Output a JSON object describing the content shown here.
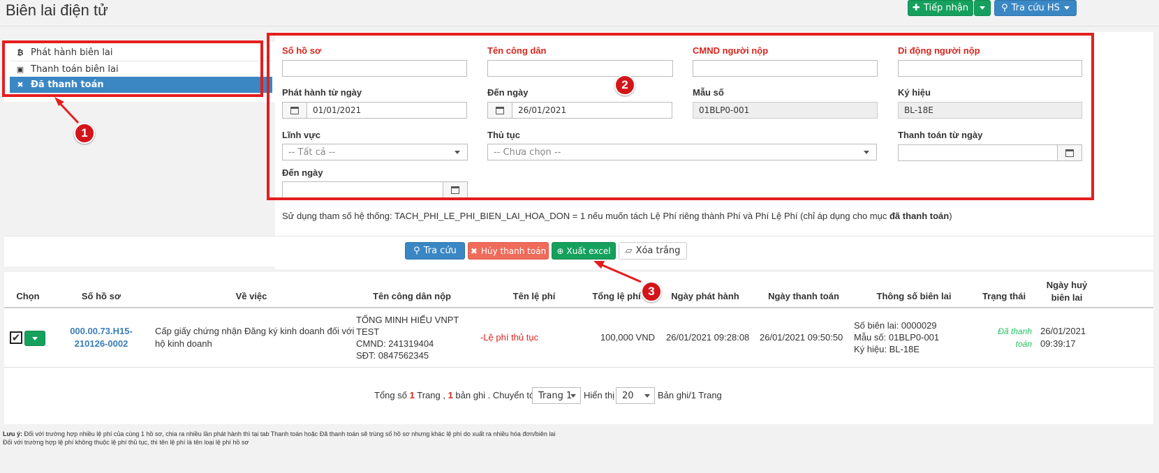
{
  "header": {
    "title": "Biên lai điện tử",
    "btn_tiep_nhan": "Tiếp nhận",
    "btn_tra_cuu_hs": "Tra cứu HS"
  },
  "menu": {
    "items": [
      {
        "icon": "bitcoin-icon",
        "glyph": "₿",
        "label": "Phát hành biên lai"
      },
      {
        "icon": "money-icon",
        "glyph": "▣",
        "label": "Thanh toán biên lai"
      },
      {
        "icon": "close-icon",
        "glyph": "✖",
        "label": "Đã thanh toán"
      }
    ]
  },
  "form": {
    "so_ho_so_label": "Số hồ sơ",
    "ten_cong_dan_label": "Tên công dân",
    "cmnd_label": "CMND người nộp",
    "di_dong_label": "Di động người nộp",
    "phat_hanh_tu_ngay_label": "Phát hành từ ngày",
    "phat_hanh_tu_ngay_value": "01/01/2021",
    "den_ngay_label": "Đến ngày",
    "den_ngay_value": "26/01/2021",
    "mau_so_label": "Mẫu số",
    "mau_so_value": "01BLP0-001",
    "ky_hieu_label": "Ký hiệu",
    "ky_hieu_value": "BL-18E",
    "linh_vuc_label": "Lĩnh vực",
    "linh_vuc_value": "-- Tất cả --",
    "thu_tuc_label": "Thủ tục",
    "thu_tuc_value": "-- Chưa chọn --",
    "thanh_toan_tu_ngay_label": "Thanh toán từ ngày",
    "den_ngay2_label": "Đến ngày"
  },
  "note": {
    "prefix": "Sử dụng tham số hệ thống: TACH_PHI_LE_PHI_BIEN_LAI_HOA_DON = 1 nếu muốn tách Lệ Phí riêng thành Phí và Phí Lệ Phí (chỉ áp dụng cho mục ",
    "bold": "đã thanh toán",
    "suffix": ")"
  },
  "actions": {
    "tra_cuu": "Tra cứu",
    "huy_thanh_toan": "Hủy thanh toán",
    "xuat_excel": "Xuất excel",
    "xoa_trang": "Xóa trắng"
  },
  "annotations": [
    "1",
    "2",
    "3"
  ],
  "table": {
    "headers": {
      "chon": "Chọn",
      "so_ho_so": "Số hồ sơ",
      "ve_viec": "Về việc",
      "ten_cong_dan": "Tên công dân nộp",
      "ten_le_phi": "Tên lệ phí",
      "tong_le_phi": "Tổng lệ phí",
      "ngay_phat_hanh": "Ngày phát hành",
      "ngay_thanh_toan": "Ngày thanh toán",
      "thong_so": "Thông số biên lai",
      "trang_thai": "Trạng thái",
      "ngay_huy_1": "Ngày huỷ",
      "ngay_huy_2": "biên lai"
    },
    "row": {
      "so_ho_so_1": "000.00.73.H15-",
      "so_ho_so_2": "210126-0002",
      "ve_viec_1": "Cấp giấy chứng nhận Đăng ký kinh doanh đối với",
      "ve_viec_2": "hộ kinh doanh",
      "cong_dan_1": "TỐNG MINH HIẾU VNPT",
      "cong_dan_2": "TEST",
      "cong_dan_3": "CMND: 241319404",
      "cong_dan_4": "SĐT: 0847562345",
      "le_phi": "-Lệ phí thủ tục",
      "tong": "100,000 VND",
      "ngay_phat_hanh": "26/01/2021 09:28:08",
      "ngay_thanh_toan": "26/01/2021 09:50:50",
      "so_bien_lai": "Số biên lai: 0000029",
      "mau_so": "Mẫu số: 01BLP0-001",
      "ky_hieu": "Ký hiệu: BL-18E",
      "trang_thai_1": "Đã thanh",
      "trang_thai_2": "toán",
      "ngay_huy_1": "26/01/2021",
      "ngay_huy_2": "09:39:17"
    }
  },
  "pagination": {
    "tong_so": "Tổng số",
    "so_trang": "1",
    "trang": "Trang ,",
    "so_ban_ghi": "1",
    "ban_ghi_chuyen": "bản ghi . Chuyển tới",
    "trang_select": "Trang 1",
    "hien_thi": "Hiển thị",
    "page_size": "20",
    "ban_ghi_trang": "Bản ghi/1 Trang"
  },
  "footer": {
    "luu_y": "Lưu ý:",
    "line1": "Đối với trường hợp nhiều lệ phí của cùng 1 hồ sơ, chia ra nhiều lần phát hành thì tại tab Thanh toán hoặc Đã thanh toán sẽ trùng số hồ sơ nhưng khác lệ phí do xuất ra nhiều hóa đơn/biên lai",
    "line2": "Đối với trường hợp lệ phí không thuộc lệ phí thủ tục, thì tên lệ phí là tên loại lệ phí hồ sơ"
  }
}
